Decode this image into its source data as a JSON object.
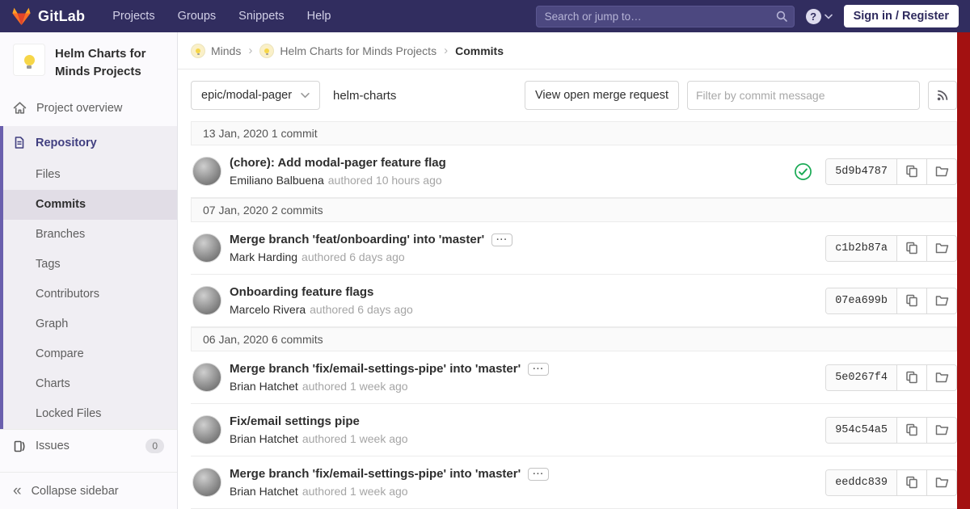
{
  "colors": {
    "navbar_bg": "#312d5f",
    "accent_purple": "#6a5fad",
    "success_green": "#1aaa55",
    "scroll_indicator_red": "#a31111",
    "brand_orange": "#fc6d26"
  },
  "navbar": {
    "logo_text": "GitLab",
    "menu": [
      "Projects",
      "Groups",
      "Snippets",
      "Help"
    ],
    "search_placeholder": "Search or jump to…",
    "help_glyph": "?",
    "sign_in_label": "Sign in / Register"
  },
  "sidebar": {
    "project_title": "Helm Charts for Minds Projects",
    "project_overview_label": "Project overview",
    "repository": {
      "label": "Repository",
      "items": [
        {
          "label": "Files",
          "active": false
        },
        {
          "label": "Commits",
          "active": true
        },
        {
          "label": "Branches",
          "active": false
        },
        {
          "label": "Tags",
          "active": false
        },
        {
          "label": "Contributors",
          "active": false
        },
        {
          "label": "Graph",
          "active": false
        },
        {
          "label": "Compare",
          "active": false
        },
        {
          "label": "Charts",
          "active": false
        },
        {
          "label": "Locked Files",
          "active": false
        }
      ]
    },
    "issues_label": "Issues",
    "issues_count": "0",
    "collapse_label": "Collapse sidebar",
    "collapse_glyph": "«"
  },
  "breadcrumb": {
    "separator_glyph": "›",
    "items": [
      {
        "label": "Minds",
        "has_avatar": true,
        "current": false
      },
      {
        "label": "Helm Charts for Minds Projects",
        "has_avatar": true,
        "current": false
      },
      {
        "label": "Commits",
        "has_avatar": false,
        "current": true
      }
    ]
  },
  "toolbar": {
    "branch_selector_value": "epic/modal-pager",
    "repo_name": "helm-charts",
    "view_mr_label": "View open merge request",
    "filter_placeholder": "Filter by commit message"
  },
  "icons": {
    "ellipsis_glyph": "···"
  },
  "commits": {
    "groups": [
      {
        "date_header": "13 Jan, 2020 1 commit",
        "commits": [
          {
            "title": "(chore): Add modal-pager feature flag",
            "author": "Emiliano Balbuena",
            "authored": "authored 10 hours ago",
            "sha": "5d9b4787",
            "pipeline_passed": true,
            "expandable": false
          }
        ]
      },
      {
        "date_header": "07 Jan, 2020 2 commits",
        "commits": [
          {
            "title": "Merge branch 'feat/onboarding' into 'master'",
            "author": "Mark Harding",
            "authored": "authored 6 days ago",
            "sha": "c1b2b87a",
            "pipeline_passed": false,
            "expandable": true
          },
          {
            "title": "Onboarding feature flags",
            "author": "Marcelo Rivera",
            "authored": "authored 6 days ago",
            "sha": "07ea699b",
            "pipeline_passed": false,
            "expandable": false
          }
        ]
      },
      {
        "date_header": "06 Jan, 2020 6 commits",
        "commits": [
          {
            "title": "Merge branch 'fix/email-settings-pipe' into 'master'",
            "author": "Brian Hatchet",
            "authored": "authored 1 week ago",
            "sha": "5e0267f4",
            "pipeline_passed": false,
            "expandable": true
          },
          {
            "title": "Fix/email settings pipe",
            "author": "Brian Hatchet",
            "authored": "authored 1 week ago",
            "sha": "954c54a5",
            "pipeline_passed": false,
            "expandable": false
          },
          {
            "title": "Merge branch 'fix/email-settings-pipe' into 'master'",
            "author": "Brian Hatchet",
            "authored": "authored 1 week ago",
            "sha": "eeddc839",
            "pipeline_passed": false,
            "expandable": true
          }
        ]
      }
    ]
  }
}
